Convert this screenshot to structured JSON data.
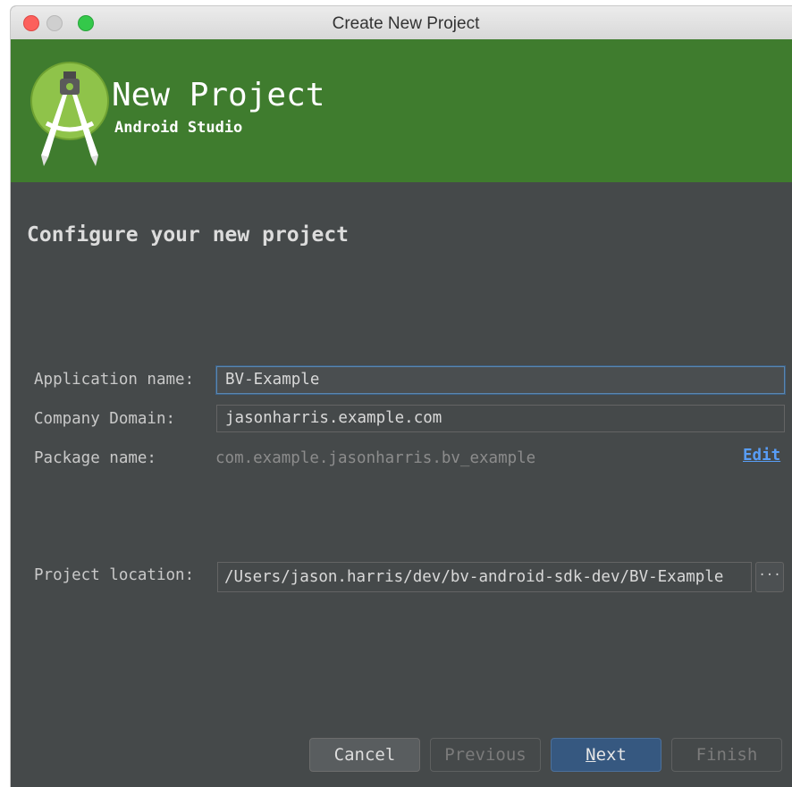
{
  "window": {
    "title": "Create New Project"
  },
  "banner": {
    "title": "New Project",
    "subtitle": "Android Studio"
  },
  "content": {
    "heading": "Configure your new project",
    "app_name_label": "Application name:",
    "app_name_value": "BV-Example",
    "company_domain_label": "Company Domain:",
    "company_domain_value": "jasonharris.example.com",
    "package_name_label": "Package name:",
    "package_name_value": "com.example.jasonharris.bv_example",
    "edit_link": "Edit",
    "project_location_label": "Project location:",
    "project_location_value": "/Users/jason.harris/dev/bv-android-sdk-dev/BV-Example",
    "browse_label": "···"
  },
  "buttons": {
    "cancel": "Cancel",
    "previous": "Previous",
    "next_mnemonic": "N",
    "next_rest": "ext",
    "finish": "Finish"
  },
  "colors": {
    "banner_green": "#3f7c2e",
    "panel_bg": "#45494a",
    "link_blue": "#589df6",
    "default_button": "#365880"
  },
  "icons": {
    "logo": "android-studio-logo-icon"
  }
}
